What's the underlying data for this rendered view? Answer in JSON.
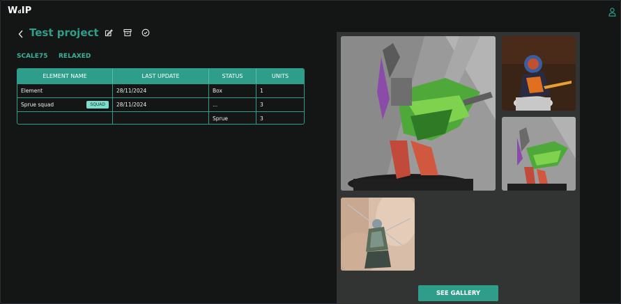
{
  "app": {
    "logo": "W",
    "logo_small": "d",
    "logo_tail": "IP"
  },
  "header": {
    "title": "Test project"
  },
  "meta": {
    "brand": "SCALE75",
    "mode": "RELAXED"
  },
  "table": {
    "columns": [
      "ELEMENT NAME",
      "LAST UPDATE",
      "STATUS",
      "UNITS"
    ],
    "rows": [
      {
        "name": "Element",
        "badge": "",
        "updated": "28/11/2024",
        "status": "Box",
        "units": "1"
      },
      {
        "name": "Sprue squad",
        "badge": "SQUAD",
        "updated": "28/11/2024",
        "status": "...",
        "units": "3"
      },
      {
        "name": "",
        "badge": "",
        "updated": "",
        "status": "Sprue",
        "units": "3"
      }
    ]
  },
  "gallery": {
    "button_label": "SEE GALLERY"
  },
  "colors": {
    "accent": "#2e9e8a",
    "background": "#141515",
    "panel": "#323433",
    "badge": "#7fdccb"
  },
  "icons": [
    "user-icon",
    "back-chevron-icon",
    "edit-icon",
    "archive-icon",
    "check-circle-icon"
  ]
}
